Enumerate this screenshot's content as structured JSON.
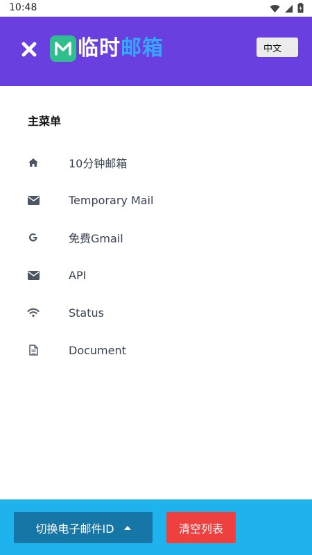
{
  "status_bar": {
    "time": "10:48",
    "icons": [
      "wifi-icon",
      "signal-icon",
      "battery-icon"
    ]
  },
  "header": {
    "close_icon": "close-icon",
    "logo": {
      "badge_letter": "M",
      "text_part1": "临时",
      "text_part2": "邮箱"
    },
    "language_button": "中文",
    "colors": {
      "background": "#6a3fe0",
      "logo_badge": "#2fbf8f",
      "logo_accent": "#35a7ff"
    }
  },
  "menu": {
    "title": "主菜单",
    "items": [
      {
        "icon": "home-icon",
        "label": "10分钟邮箱"
      },
      {
        "icon": "envelope-icon",
        "label": "Temporary Mail"
      },
      {
        "icon": "google-icon",
        "label": "免费Gmail"
      },
      {
        "icon": "envelope-icon",
        "label": "API"
      },
      {
        "icon": "wifi-icon",
        "label": "Status"
      },
      {
        "icon": "document-icon",
        "label": "Document"
      }
    ]
  },
  "footer": {
    "switch_button": "切换电子邮件ID",
    "clear_button": "清空列表",
    "colors": {
      "background": "#1fb3ee",
      "switch": "#1677a6",
      "clear": "#ef4040"
    }
  }
}
